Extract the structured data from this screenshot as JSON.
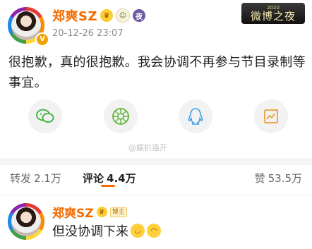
{
  "post": {
    "author_name": "郑爽SZ",
    "time": "20-12-26 23:07",
    "night_banner": {
      "year": "2020",
      "title": "微博之夜"
    },
    "text": "很抱歉，真的很抱歉。我会协调不再参与节目录制等事宜。",
    "share_buttons": [
      "wechat-icon",
      "moments-icon",
      "qq-icon",
      "image-share-icon"
    ],
    "watermark": "@娱扒连开",
    "icons": {
      "vip": "vip-icon",
      "smile": "face-icon",
      "night": "夜"
    }
  },
  "stats": {
    "repost_label": "转发",
    "repost_count": "2.1万",
    "comment_label": "评论",
    "comment_count": "4.4万",
    "like_label": "赞",
    "like_count": "53.5万"
  },
  "comment": {
    "author_name": "郑爽SZ",
    "owner_tag": "博主",
    "text": "但没协调下来"
  },
  "colors": {
    "accent": "#f56b00",
    "muted": "#8c8c8c"
  }
}
